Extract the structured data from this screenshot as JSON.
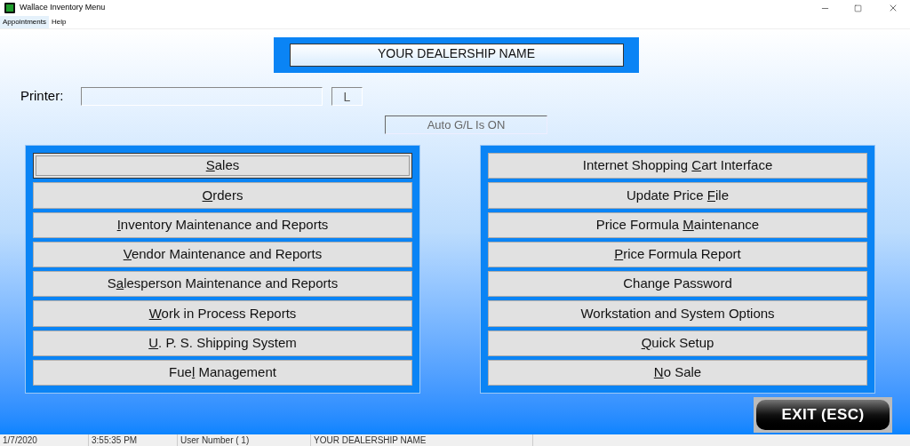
{
  "window": {
    "title": "Wallace Inventory Menu"
  },
  "menu_bar": [
    {
      "label": "Appointments",
      "selected": true
    },
    {
      "label": "Help",
      "selected": false
    }
  ],
  "dealership_name": "YOUR DEALERSHIP NAME",
  "printer": {
    "label": "Printer:",
    "code": "L"
  },
  "gl_status": "Auto G/L Is ON",
  "left_buttons": [
    {
      "key": "S",
      "after": "ales",
      "selected": true
    },
    {
      "key": "O",
      "after": "rders",
      "selected": false
    },
    {
      "key": "I",
      "after": "nventory Maintenance and Reports",
      "selected": false
    },
    {
      "key": "V",
      "after": "endor Maintenance and Reports",
      "selected": false
    },
    {
      "before": "S",
      "key": "a",
      "after": "lesperson Maintenance and Reports",
      "selected": false
    },
    {
      "key": "W",
      "after": "ork in Process Reports",
      "selected": false
    },
    {
      "key": "U",
      "after": ". P. S. Shipping System",
      "selected": false
    },
    {
      "before": "Fue",
      "key": "l",
      "after": " Management",
      "selected": false
    }
  ],
  "right_buttons": [
    {
      "before": "Internet Shopping ",
      "key": "C",
      "after": "art Interface",
      "selected": false
    },
    {
      "before": "Update Price ",
      "key": "F",
      "after": "ile",
      "selected": false
    },
    {
      "before": "Price Formula ",
      "key": "M",
      "after": "aintenance",
      "selected": false
    },
    {
      "key": "P",
      "after": "rice Formula Report",
      "selected": false
    },
    {
      "before": "Change Password",
      "selected": false
    },
    {
      "before": "Workstation and System Options",
      "selected": false
    },
    {
      "key": "Q",
      "after": "uick Setup",
      "selected": false
    },
    {
      "key": "N",
      "after": "o Sale",
      "selected": false
    }
  ],
  "exit_button": "EXIT (ESC)",
  "status_bar": [
    "1/7/2020",
    "3:55:35 PM",
    "User Number ( 1)",
    "YOUR DEALERSHIP NAME"
  ]
}
